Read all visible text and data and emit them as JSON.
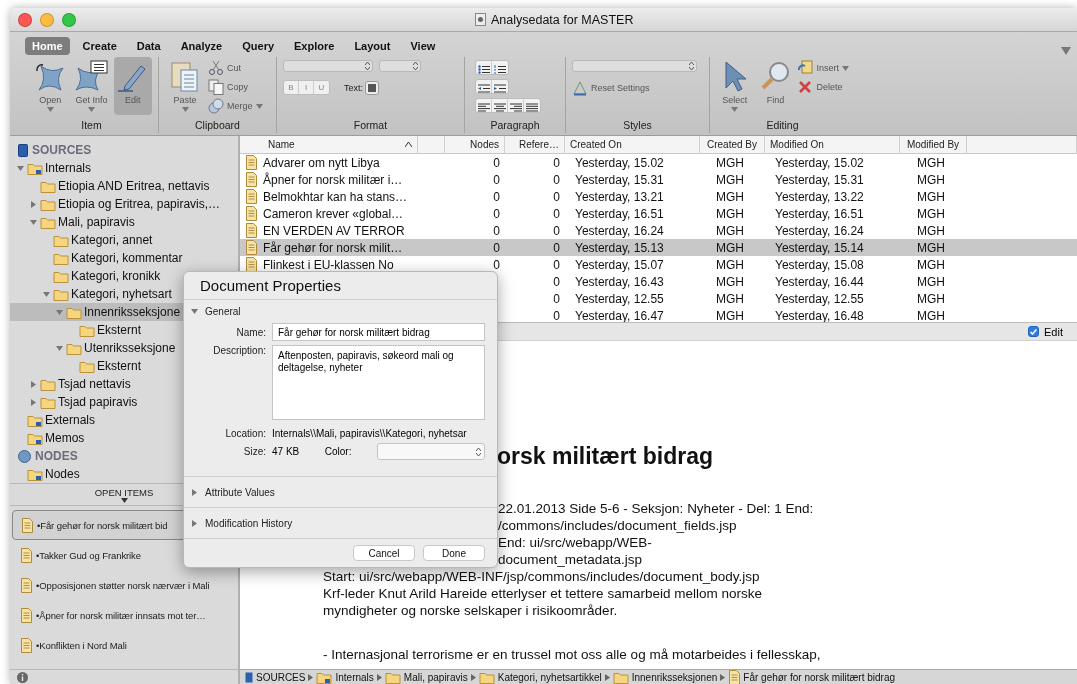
{
  "window": {
    "title": "Analysedata for MASTER"
  },
  "ribbon": {
    "tabs": [
      {
        "label": "Home",
        "selected": true
      },
      {
        "label": "Create",
        "selected": false
      },
      {
        "label": "Data",
        "selected": false
      },
      {
        "label": "Analyze",
        "selected": false
      },
      {
        "label": "Query",
        "selected": false
      },
      {
        "label": "Explore",
        "selected": false
      },
      {
        "label": "Layout",
        "selected": false
      },
      {
        "label": "View",
        "selected": false
      }
    ],
    "groups": [
      {
        "kind": "item",
        "label": "Item",
        "tools": [
          {
            "label": "Open",
            "kind": "large",
            "menu": true,
            "pressed": false
          },
          {
            "label": "Get Info",
            "kind": "large",
            "menu": true,
            "pressed": false
          },
          {
            "label": "Edit",
            "kind": "large",
            "menu": false,
            "pressed": true
          }
        ]
      },
      {
        "kind": "clipboard",
        "label": "Clipboard",
        "tools": [
          {
            "label": "Paste",
            "kind": "large",
            "menu": true,
            "pressed": false
          },
          {
            "label": "Cut",
            "kind": "small",
            "menu": false,
            "pressed": false
          },
          {
            "label": "Copy",
            "kind": "small",
            "menu": false,
            "pressed": false
          },
          {
            "label": "Merge",
            "kind": "small",
            "menu": true,
            "pressed": false
          }
        ]
      },
      {
        "kind": "format",
        "label": "Format",
        "styles": [
          "B",
          "I",
          "U"
        ],
        "color_label": "Text:"
      },
      {
        "kind": "paragraph",
        "label": "Paragraph"
      },
      {
        "kind": "styles",
        "label": "Styles",
        "tools": [
          {
            "label": "Reset Settings",
            "kind": "small",
            "menu": false,
            "pressed": false
          }
        ]
      },
      {
        "kind": "editing",
        "label": "Editing",
        "tools": [
          {
            "label": "Select",
            "kind": "large",
            "menu": true,
            "pressed": false
          },
          {
            "label": "Find",
            "kind": "large",
            "menu": false,
            "pressed": false
          },
          {
            "label": "Insert",
            "kind": "small",
            "menu": true,
            "pressed": false
          },
          {
            "label": "Delete",
            "kind": "small",
            "menu": false,
            "pressed": false
          }
        ]
      }
    ]
  },
  "sidebar": {
    "sections": [
      {
        "kind": "sources",
        "label": "SOURCES",
        "items": [
          {
            "label": "Internals",
            "selected": false,
            "expanded": true,
            "children": [
              {
                "label": "Etiopia AND Eritrea, nettavis",
                "selected": false
              },
              {
                "label": "Etiopia og Eritrea, papiravis,…",
                "selected": false,
                "expanded": false
              },
              {
                "label": "Mali, papiravis",
                "selected": false,
                "expanded": true,
                "children": [
                  {
                    "label": "Kategori, annet",
                    "selected": false
                  },
                  {
                    "label": "Kategori, kommentar",
                    "selected": false
                  },
                  {
                    "label": "Kategori, kronikk",
                    "selected": false
                  },
                  {
                    "label": "Kategori, nyhetsart",
                    "selected": false,
                    "expanded": true,
                    "children": [
                      {
                        "label": "Innenriksseksjone",
                        "selected": true,
                        "expanded": true,
                        "children": [
                          {
                            "label": "Eksternt",
                            "selected": false
                          }
                        ]
                      },
                      {
                        "label": "Utenriksseksjone",
                        "selected": false,
                        "expanded": true,
                        "children": [
                          {
                            "label": "Eksternt",
                            "selected": false
                          }
                        ]
                      }
                    ]
                  }
                ]
              },
              {
                "label": "Tsjad nettavis",
                "selected": false,
                "expanded": false
              },
              {
                "label": "Tsjad papiravis",
                "selected": false,
                "expanded": false
              }
            ]
          },
          {
            "label": "Externals",
            "selected": false
          },
          {
            "label": "Memos",
            "selected": false
          }
        ]
      },
      {
        "kind": "nodes",
        "label": "NODES",
        "items": [
          {
            "label": "Nodes",
            "selected": false
          }
        ]
      }
    ],
    "open_items_label": "OPEN ITEMS",
    "open_items": [
      {
        "label": "•Får gehør for norsk militært bid",
        "selected": true
      },
      {
        "label": "•Takker Gud og Frankrike",
        "selected": false
      },
      {
        "label": "•Opposisjonen støtter norsk nærvær i Mali",
        "selected": false
      },
      {
        "label": "•Åpner for norsk militær innsats mot ter…",
        "selected": false
      },
      {
        "label": "•Konflikten i Nord Mali",
        "selected": false
      }
    ]
  },
  "table": {
    "columns": [
      "Name",
      "Nodes",
      "Refere…",
      "Created On",
      "Created By",
      "Modified On",
      "Modified By"
    ],
    "rows": [
      {
        "name": "Advarer om nytt Libya",
        "nodes": "0",
        "references": "0",
        "created_on": "Yesterday, 15.02",
        "created_by": "MGH",
        "modified_on": "Yesterday, 15.02",
        "modified_by": "MGH",
        "selected": false
      },
      {
        "name": "Åpner for norsk militær i…",
        "nodes": "0",
        "references": "0",
        "created_on": "Yesterday, 15.31",
        "created_by": "MGH",
        "modified_on": "Yesterday, 15.31",
        "modified_by": "MGH",
        "selected": false
      },
      {
        "name": "Belmokhtar kan ha stans…",
        "nodes": "0",
        "references": "0",
        "created_on": "Yesterday, 13.21",
        "created_by": "MGH",
        "modified_on": "Yesterday, 13.22",
        "modified_by": "MGH",
        "selected": false
      },
      {
        "name": "Cameron krever «global…",
        "nodes": "0",
        "references": "0",
        "created_on": "Yesterday, 16.51",
        "created_by": "MGH",
        "modified_on": "Yesterday, 16.51",
        "modified_by": "MGH",
        "selected": false
      },
      {
        "name": "EN VERDEN AV TERROR",
        "nodes": "0",
        "references": "0",
        "created_on": "Yesterday, 16.24",
        "created_by": "MGH",
        "modified_on": "Yesterday, 16.24",
        "modified_by": "MGH",
        "selected": false
      },
      {
        "name": "Får gehør for norsk milit…",
        "nodes": "0",
        "references": "0",
        "created_on": "Yesterday, 15.13",
        "created_by": "MGH",
        "modified_on": "Yesterday, 15.14",
        "modified_by": "MGH",
        "selected": true
      },
      {
        "name": "Flinkest i EU-klassen No",
        "nodes": "0",
        "references": "0",
        "created_on": "Yesterday, 15.07",
        "created_by": "MGH",
        "modified_on": "Yesterday, 15.08",
        "modified_by": "MGH",
        "selected": false
      },
      {
        "references": "0",
        "created_on": "Yesterday, 16.43",
        "created_by": "MGH",
        "modified_on": "Yesterday, 16.44",
        "modified_by": "MGH",
        "selected": false
      },
      {
        "references": "0",
        "created_on": "Yesterday, 12.55",
        "created_by": "MGH",
        "modified_on": "Yesterday, 12.55",
        "modified_by": "MGH",
        "selected": false
      },
      {
        "references": "0",
        "created_on": "Yesterday, 16.47",
        "created_by": "MGH",
        "modified_on": "Yesterday, 16.48",
        "modified_by": "MGH",
        "selected": false
      }
    ]
  },
  "edit_toggle": {
    "label": "Edit",
    "checked": true
  },
  "document": {
    "heading": "orsk militært bidrag",
    "lines": [
      {
        "kind": "covered",
        "text": "22.01.2013 Side 5-6  -  Seksjon: Nyheter  -  Del: 1 End:"
      },
      {
        "kind": "covered",
        "text": "/commons/includes/document_fields.jsp"
      },
      {
        "kind": "covered",
        "text": "End: ui/src/webapp/WEB-"
      },
      {
        "kind": "covered",
        "text": "document_metadata.jsp"
      },
      {
        "kind": "line",
        "text": "Start: ui/src/webapp/WEB-INF/jsp/commons/includes/document_body.jsp"
      },
      {
        "kind": "line",
        "text": "Krf-leder Knut Arild Hareide etterlyser et tettere samarbeid mellom norske"
      },
      {
        "kind": "line",
        "text": "myndigheter og norske selskaper i risikoområder."
      },
      {
        "kind": "paragraph",
        "text": "- Internasjonal terrorisme er en trussel mot oss alle og må motarbeides i fellesskap,"
      }
    ]
  },
  "breadcrumb": [
    "SOURCES",
    "Internals",
    "Mali, papiravis",
    "Kategori, nyhetsartikkel",
    "Innenriksseksjonen",
    "Får gehør for norsk militært bidrag"
  ],
  "dialog": {
    "title": "Document Properties",
    "sections": [
      {
        "label": "General",
        "expanded": true
      },
      {
        "label": "Attribute Values",
        "expanded": false
      },
      {
        "label": "Modification History",
        "expanded": false
      }
    ],
    "name_label": "Name:",
    "name": "Får gehør for norsk militært bidrag",
    "description_label": "Description:",
    "description": "Aftenposten, papiravis, søkeord mali og deltagelse, nyheter",
    "location_label": "Location:",
    "location": "Internals\\\\Mali, papiravis\\\\Kategori, nyhetsar",
    "size_label": "Size:",
    "size": "47 KB",
    "color_label": "Color:",
    "buttons": [
      "Cancel",
      "Done"
    ]
  }
}
